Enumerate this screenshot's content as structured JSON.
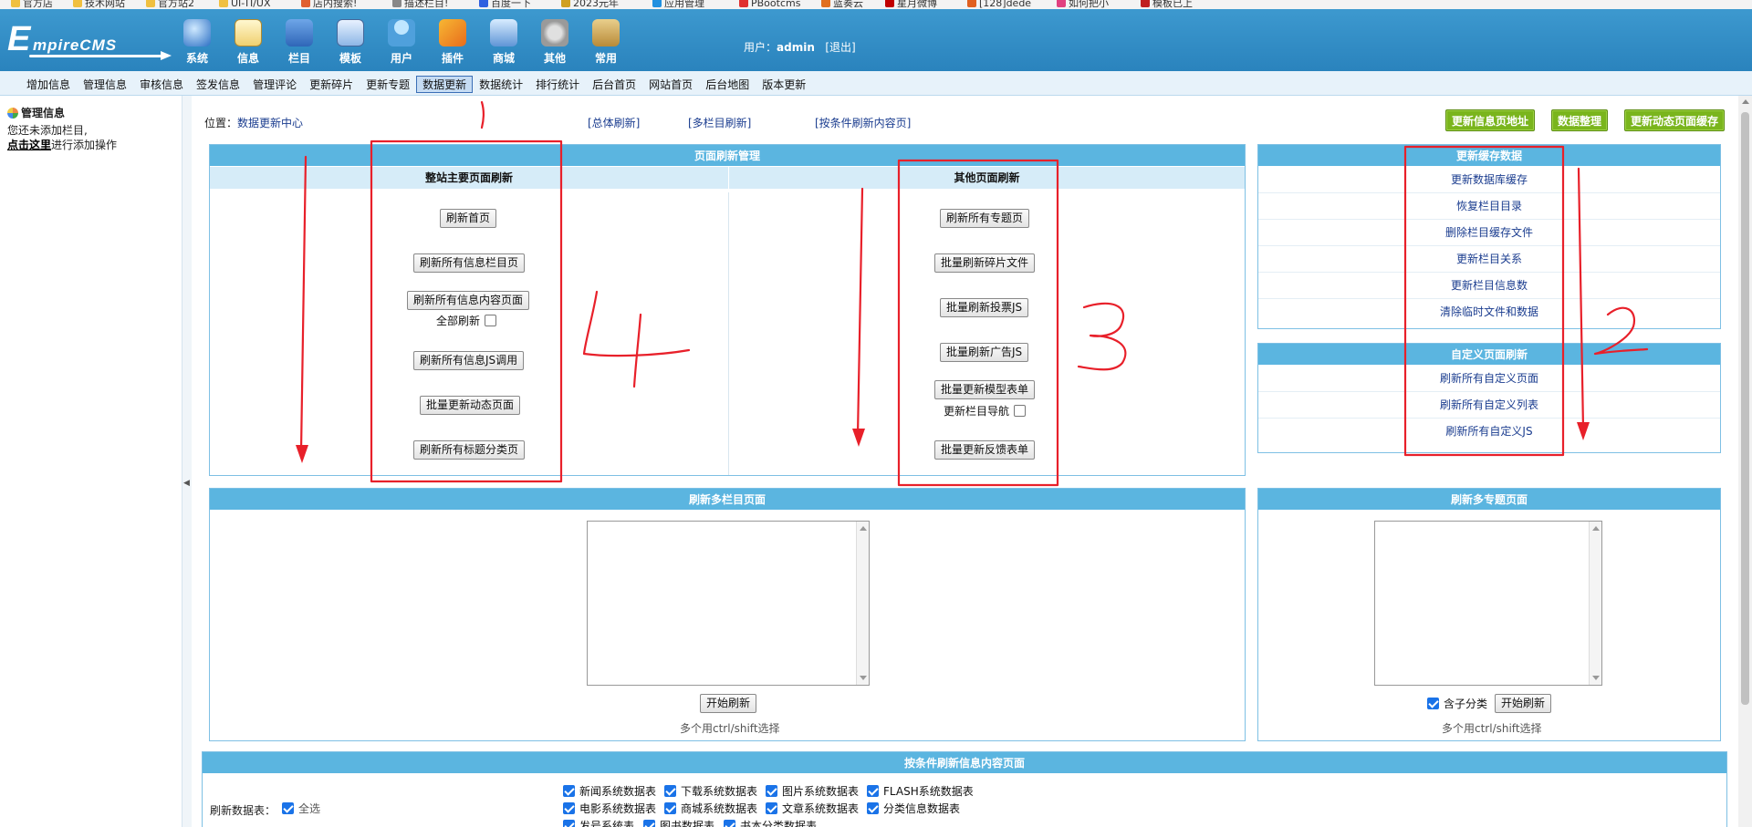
{
  "bookmarks": [
    "官方店",
    "技术网站",
    "官方站2",
    "UI-TI/UX",
    "店内搜索!",
    "描述栏目!",
    "百度一下",
    "2023元年",
    "应用管理",
    "PBootcms",
    "蓝奏云",
    "星月微博",
    "[128]dede",
    "如何把小",
    "模板已上"
  ],
  "header": {
    "logo_letter": "E",
    "logo_rest": "mpireCMS",
    "nav": [
      {
        "label": "系统",
        "icon": "globe-icon"
      },
      {
        "label": "信息",
        "icon": "notepad-icon"
      },
      {
        "label": "栏目",
        "icon": "folder-icon"
      },
      {
        "label": "模板",
        "icon": "window-icon"
      },
      {
        "label": "用户",
        "icon": "user-icon"
      },
      {
        "label": "插件",
        "icon": "tools-icon"
      },
      {
        "label": "商城",
        "icon": "shop-icon"
      },
      {
        "label": "其他",
        "icon": "gear-icon"
      },
      {
        "label": "常用",
        "icon": "box-icon"
      }
    ],
    "user_prefix": "用户：",
    "username": "admin",
    "logout": "[退出]"
  },
  "submenu": [
    "增加信息",
    "管理信息",
    "审核信息",
    "签发信息",
    "管理评论",
    "更新碎片",
    "更新专题",
    "数据更新",
    "数据统计",
    "排行统计",
    "后台首页",
    "网站首页",
    "后台地图",
    "版本更新"
  ],
  "submenu_active": "数据更新",
  "left": {
    "title": "管理信息",
    "line1": "您还未添加栏目,",
    "link": "点击这里",
    "line2_rest": "进行添加操作"
  },
  "location": {
    "prefix": "位置：",
    "link": "数据更新中心"
  },
  "toplinks": [
    "[总体刷新]",
    "[多栏目刷新]",
    "[按条件刷新内容页]"
  ],
  "green_buttons": [
    "更新信息页地址",
    "数据整理",
    "更新动态页面缓存"
  ],
  "page_refresh": {
    "title": "页面刷新管理",
    "left_title": "整站主要页面刷新",
    "right_title": "其他页面刷新",
    "left_buttons": [
      "刷新首页",
      "刷新所有信息栏目页",
      "刷新所有信息内容页面",
      "刷新所有信息JS调用",
      "批量更新动态页面",
      "刷新所有标题分类页"
    ],
    "all_refresh_label": "全部刷新",
    "right_buttons": [
      "刷新所有专题页",
      "批量刷新碎片文件",
      "批量刷新投票JS",
      "批量刷新广告JS",
      "批量更新模型表单",
      "批量更新反馈表单"
    ],
    "nav_label": "更新栏目导航"
  },
  "cache": {
    "title": "更新缓存数据",
    "items": [
      "更新数据库缓存",
      "恢复栏目目录",
      "删除栏目缓存文件",
      "更新栏目关系",
      "更新栏目信息数",
      "清除临时文件和数据"
    ]
  },
  "custom": {
    "title": "自定义页面刷新",
    "items": [
      "刷新所有自定义页面",
      "刷新所有自定义列表",
      "刷新所有自定义JS"
    ]
  },
  "multi_col": {
    "title": "刷新多栏目页面",
    "button": "开始刷新",
    "hint": "多个用ctrl/shift选择"
  },
  "multi_topic": {
    "title": "刷新多专题页面",
    "sub_label": "含子分类",
    "button": "开始刷新",
    "hint": "多个用ctrl/shift选择"
  },
  "condition": {
    "title": "按条件刷新信息内容页面",
    "tables_label": "刷新数据表：",
    "select_all": "全选",
    "tables_row1": [
      "新闻系统数据表",
      "下载系统数据表",
      "图片系统数据表",
      "FLASH系统数据表"
    ],
    "tables_row2": [
      "电影系统数据表",
      "商城系统数据表",
      "文章系统数据表",
      "分类信息数据表"
    ],
    "tables_row3": [
      "发号系统表",
      "图书数据表",
      "书本分类数据表"
    ]
  },
  "annotations": [
    "1",
    "2",
    "3",
    "4"
  ],
  "colors": {
    "header": "#2a83bd",
    "box_header": "#5bb5e0",
    "green": "#7ab51d",
    "annotation": "#e8202a"
  }
}
